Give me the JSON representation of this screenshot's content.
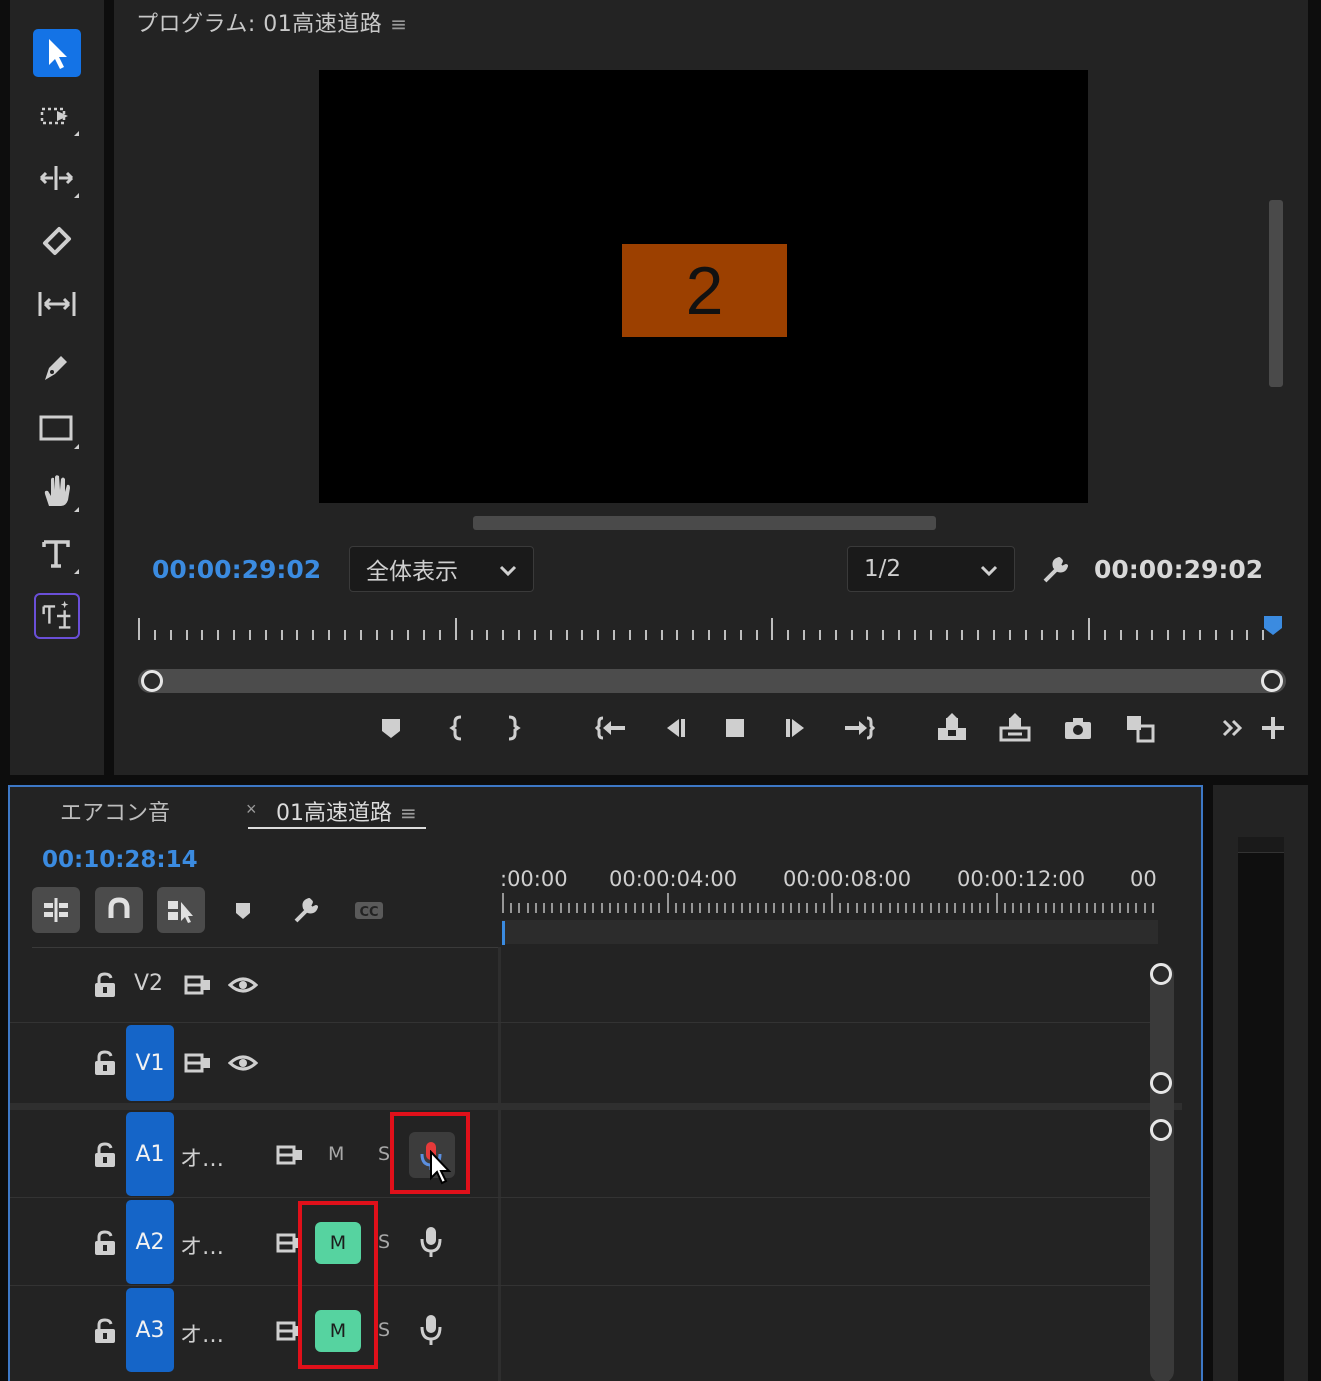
{
  "tools": [
    {
      "name": "selection",
      "icon": "arrow-pointer-icon",
      "active": true
    },
    {
      "name": "track-select-forward",
      "icon": "track-select-icon"
    },
    {
      "name": "ripple-edit",
      "icon": "ripple-edit-icon"
    },
    {
      "name": "razor",
      "icon": "razor-icon"
    },
    {
      "name": "slip",
      "icon": "slip-icon"
    },
    {
      "name": "pen",
      "icon": "pen-icon"
    },
    {
      "name": "rectangle",
      "icon": "rectangle-icon"
    },
    {
      "name": "hand",
      "icon": "hand-icon"
    },
    {
      "name": "type",
      "icon": "type-icon"
    },
    {
      "name": "generative-extend",
      "icon": "generative-extend-icon"
    }
  ],
  "monitor": {
    "title": "プログラム: 01高速道路",
    "frame_number": "2",
    "frame_color": "#9c4000",
    "current_timecode": "00:00:29:02",
    "zoom": "全体表示",
    "resolution": "1/2",
    "duration_timecode": "00:00:29:02"
  },
  "timeline": {
    "tabs": [
      {
        "label": "エアコン音",
        "active": false
      },
      {
        "label": "01高速道路",
        "active": true
      }
    ],
    "close_symbol": "×",
    "timecode": "00:10:28:14",
    "ruler_labels": [
      ":00:00",
      "00:00:04:00",
      "00:00:08:00",
      "00:00:12:00",
      "00"
    ],
    "video_tracks": [
      {
        "label": "V2",
        "targeted": false
      },
      {
        "label": "V1",
        "targeted": true
      }
    ],
    "audio_tracks": [
      {
        "label": "A1",
        "name": "オ…",
        "mute": "M",
        "solo": "S",
        "mute_on": false,
        "voiceover_recording": true
      },
      {
        "label": "A2",
        "name": "オ…",
        "mute": "M",
        "solo": "S",
        "mute_on": true,
        "voiceover_recording": false
      },
      {
        "label": "A3",
        "name": "オ…",
        "mute": "M",
        "solo": "S",
        "mute_on": true,
        "voiceover_recording": false
      }
    ]
  },
  "colors": {
    "accent_blue": "#3b8be0",
    "target_blue": "#1565c8",
    "mute_green": "#56d3a0",
    "highlight_red": "#e0101a",
    "panel_bg": "#232323"
  }
}
